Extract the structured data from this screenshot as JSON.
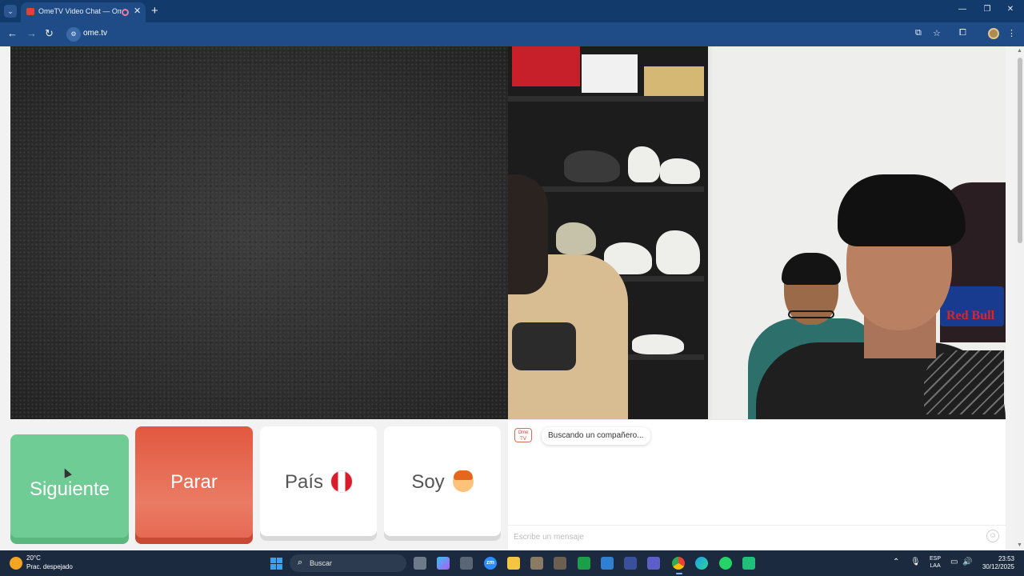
{
  "browser": {
    "tab_title": "OmeTV Video Chat — Ome",
    "url": "ome.tv",
    "icons": {
      "tab_menu": "chevron-down-icon",
      "favicon": "ometv-favicon-icon",
      "recording": "recording-icon",
      "close_tab": "close-icon",
      "new_tab": "plus-icon",
      "back": "arrow-left-icon",
      "forward": "arrow-right-icon",
      "reload": "reload-icon",
      "site_info": "site-info-icon",
      "cast": "cast-icon",
      "bookmark": "star-icon",
      "extensions": "puzzle-icon",
      "profile": "profile-avatar-icon",
      "menu": "kebab-menu-icon"
    }
  },
  "controls": {
    "next_label": "Siguiente",
    "stop_label": "Parar",
    "country_label": "País",
    "country_flag": "peru-flag-icon",
    "soy_label": "Soy",
    "soy_avatar": "boy-face-icon",
    "colors": {
      "next": "#6fcc94",
      "stop": "#e2583f",
      "card": "#ffffff"
    }
  },
  "chat": {
    "status_message": "Buscando un compañero...",
    "input_placeholder": "Escribe un mensaje",
    "logo_text": "Ome TV",
    "emoji_icon": "emoji-icon"
  },
  "video": {
    "right_sign_text": "Red Bull"
  },
  "taskbar": {
    "weather_temp": "20°C",
    "weather_desc": "Prac. despejado",
    "search_label": "Buscar",
    "lang_line1": "ESP",
    "lang_line2": "LAA",
    "time": "23:53",
    "date": "30/12/2025",
    "app_zoom": "zm"
  }
}
